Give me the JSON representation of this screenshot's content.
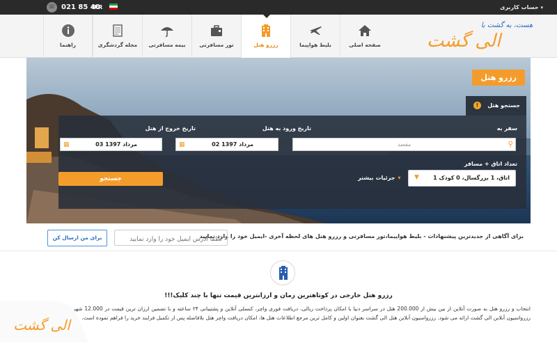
{
  "topbar": {
    "account_label": "حساب کاربری",
    "phone": "021 85 40",
    "currency": "IRR"
  },
  "nav": {
    "tabs": [
      {
        "label": "صفحه اصلی",
        "icon": "home-icon"
      },
      {
        "label": "بلیط هواپیما",
        "icon": "airplane-icon"
      },
      {
        "label": "رزرو هتل",
        "icon": "hotel-icon",
        "active": true
      },
      {
        "label": "تور مسافرتی",
        "icon": "tour-bag-icon"
      },
      {
        "label": "بیمه مسافرتی",
        "icon": "umbrella-icon"
      },
      {
        "label": "مجله گردشگری",
        "icon": "magazine-icon"
      },
      {
        "label": "راهنما",
        "icon": "info-icon"
      }
    ]
  },
  "logo": {
    "slogan": "هست، به گشت با",
    "name": "الی گشت"
  },
  "hero": {
    "badge": "رزرو هتل",
    "search_tab": "جستجو هتل",
    "destination_label": "سفر به",
    "destination_placeholder": "مقصد",
    "checkin_label": "تاریخ ورود به هتل",
    "checkin_value": "02 مرداد 1397",
    "checkout_label": "تاریخ خروج از هتل",
    "checkout_value": "03 مرداد 1397",
    "rooms_label": "تعداد اتاق + مسافر",
    "rooms_value": "1 اتاق، 1 بزرگسال، 0 کودک",
    "details_label": "جزئیات بیشتر",
    "search_button": "جستجو"
  },
  "newsletter": {
    "text": "برای آگاهی از جدیدترین پیشنهادات - بلیط هواپیما،تور مسافرتی و رزرو هتل های لحظه آخری -ایمیل خود را وارد نمایید",
    "email_placeholder": "لطفا آدرس ایمیل خود را وارد نمایید",
    "send_button": "برای من ارسال کن"
  },
  "info": {
    "title": "رزرو هتل خارجی در کوتاهترین زمان و ارزانترین قیمت تنها با چند کلیک!!!",
    "body_1": "انتخاب و رزرو هتل به صورت آنلاین از بین بیش از 200.000 هتل در سراسر دنیا با امکان پرداخت ریالی، دریافت فوری واچر، کنسلی آنلاین و پشتیبانی ۲۴ ساعته و با تضمین ارزان ترین قیمت در 12.000 شهر تنها در رزرواسیون آنلاین",
    "body_2": "الی گشت ارائه می شود. رزرواسیون آنلاین هتل الی گشت بعنوان اولین و کامل ترین مرجع اطلاعات هتل ها، امکان دریافت واچر هتل بلافاصله پس از تکمیل فرایند خرید را فراهم نموده است."
  },
  "colors": {
    "accent": "#f49c2b",
    "topbar": "#2a2a2a",
    "form_bg": "#2c3440",
    "link": "#2a6cc0"
  }
}
